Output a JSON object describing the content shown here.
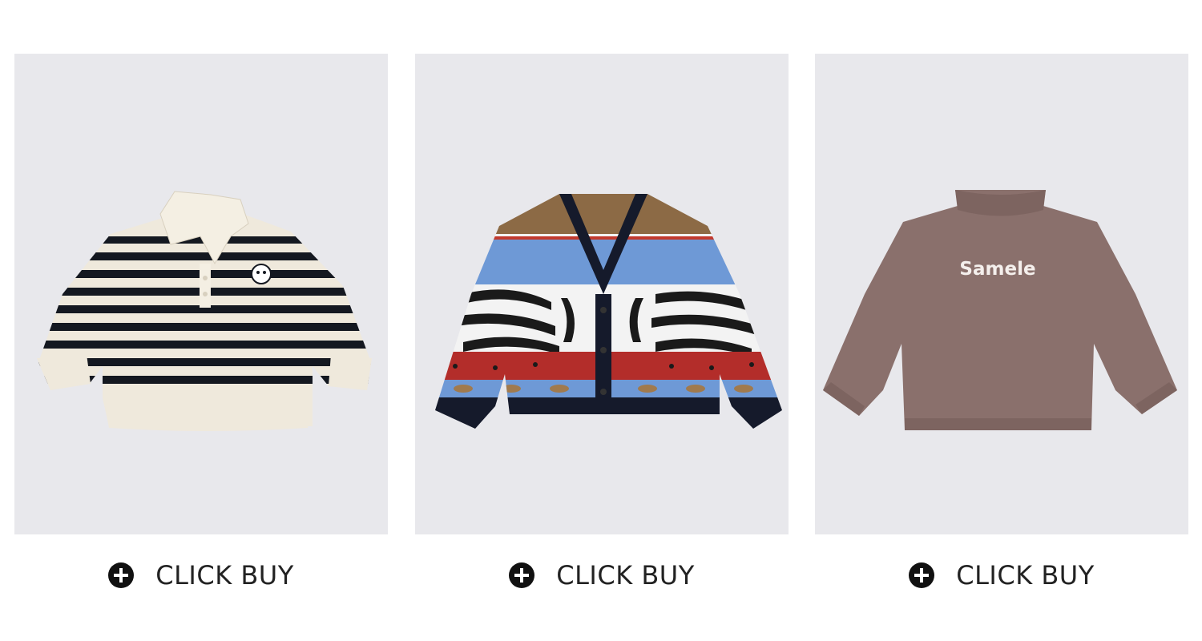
{
  "products": [
    {
      "id": "striped-polo-sweater",
      "image_icon": "striped-polo-sweater-image",
      "buy_label": "CLICK BUY"
    },
    {
      "id": "zebra-cardigan",
      "image_icon": "zebra-print-cardigan-image",
      "buy_label": "CLICK BUY"
    },
    {
      "id": "mock-neck-top",
      "image_icon": "brown-mock-neck-shirt-image",
      "print_text": "Samele",
      "buy_label": "CLICK BUY"
    }
  ],
  "colors": {
    "image_background": "#e8e8ec",
    "page_background": "#ffffff",
    "button_icon": "#111111",
    "label_text": "#222222"
  }
}
